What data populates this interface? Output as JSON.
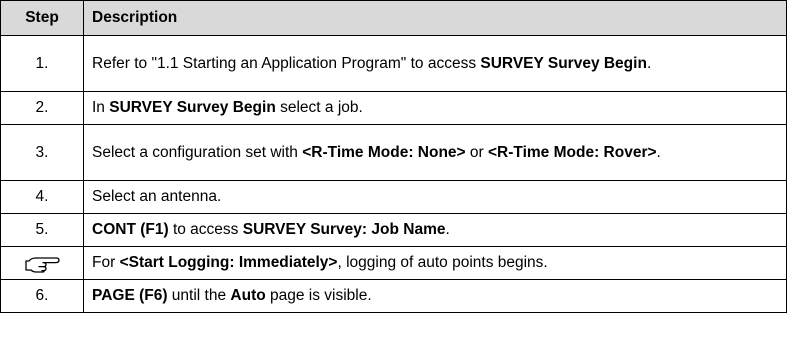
{
  "table": {
    "headers": {
      "step": "Step",
      "description": "Description"
    },
    "rows": [
      {
        "step": "1.",
        "parts": [
          {
            "text": "Refer to \"1.1 Starting an Application Program\" to access ",
            "bold": false
          },
          {
            "text": "SURVEY Survey Begin",
            "bold": true
          },
          {
            "text": ".",
            "bold": false
          }
        ]
      },
      {
        "step": "2.",
        "parts": [
          {
            "text": "In ",
            "bold": false
          },
          {
            "text": "SURVEY Survey Begin",
            "bold": true
          },
          {
            "text": " select a job.",
            "bold": false
          }
        ]
      },
      {
        "step": "3.",
        "parts": [
          {
            "text": "Select a configuration set with ",
            "bold": false
          },
          {
            "text": "<R-Time Mode: None>",
            "bold": true
          },
          {
            "text": " or ",
            "bold": false
          },
          {
            "text": "<R-Time Mode: Rover>",
            "bold": true
          },
          {
            "text": ".",
            "bold": false
          }
        ]
      },
      {
        "step": "4.",
        "parts": [
          {
            "text": "Select an antenna.",
            "bold": false
          }
        ]
      },
      {
        "step": "5.",
        "parts": [
          {
            "text": "CONT (F1)",
            "bold": true
          },
          {
            "text": " to access ",
            "bold": false
          },
          {
            "text": "SURVEY Survey: Job Name",
            "bold": true
          },
          {
            "text": ".",
            "bold": false
          }
        ]
      },
      {
        "step": "",
        "icon": "pointing-hand-icon",
        "parts": [
          {
            "text": "For ",
            "bold": false
          },
          {
            "text": "<Start Logging: Immediately>",
            "bold": true
          },
          {
            "text": ", logging of auto points begins.",
            "bold": false
          }
        ]
      },
      {
        "step": "6.",
        "parts": [
          {
            "text": "PAGE (F6)",
            "bold": true
          },
          {
            "text": " until the ",
            "bold": false
          },
          {
            "text": "Auto",
            "bold": true
          },
          {
            "text": " page is visible.",
            "bold": false
          }
        ]
      }
    ]
  }
}
